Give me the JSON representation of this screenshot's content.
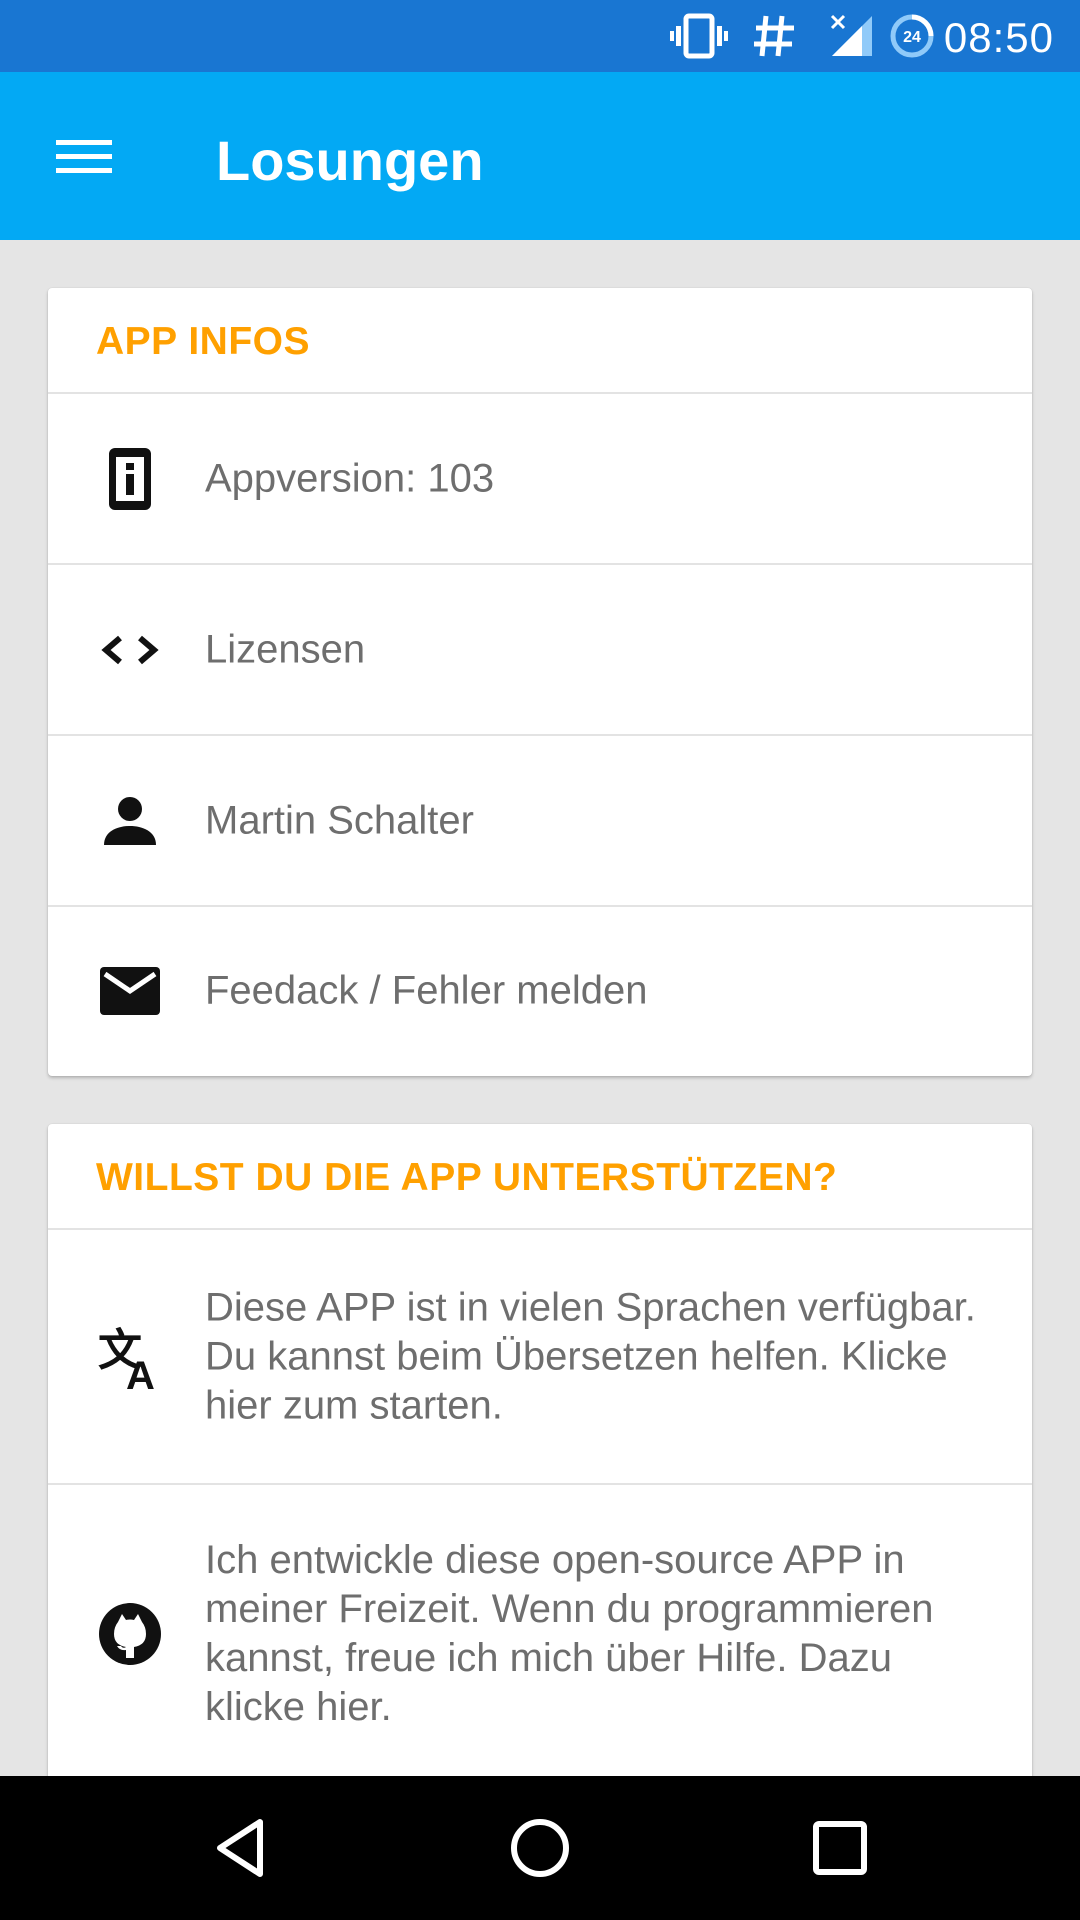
{
  "status_bar": {
    "time": "08:50",
    "icons": [
      "vibrate-icon",
      "hash-icon",
      "signal-icon",
      "data-saver-24-icon"
    ],
    "data_badge": "24",
    "background": "#1976d2"
  },
  "app_bar": {
    "title": "Losungen",
    "menu_icon": "hamburger-menu-icon",
    "background": "#03a9f4"
  },
  "cards": {
    "app_infos": {
      "title": "APP INFOS",
      "items": [
        {
          "icon": "info-icon",
          "label": "Appversion: 103"
        },
        {
          "icon": "code-icon",
          "label": "Lizensen"
        },
        {
          "icon": "person-icon",
          "label": "Martin Schalter"
        },
        {
          "icon": "mail-icon",
          "label": "Feedack / Fehler melden"
        }
      ]
    },
    "support": {
      "title": "WILLST DU DIE APP UNTERSTÜTZEN?",
      "items": [
        {
          "icon": "translate-icon",
          "label": "Diese APP ist in vielen Sprachen verfügbar. Du kannst beim Übersetzen helfen. Klicke hier zum starten."
        },
        {
          "icon": "github-icon",
          "label": "Ich entwickle diese open-source APP in meiner Freizeit. Wenn du programmieren kannst, freue ich mich über Hilfe. Dazu klicke hier."
        }
      ]
    }
  },
  "nav_bar": {
    "buttons": [
      "back-icon",
      "home-icon",
      "recents-icon"
    ]
  },
  "colors": {
    "accent": "#ffa000",
    "text_secondary": "#6e6e6e",
    "background": "#e5e5e5"
  }
}
